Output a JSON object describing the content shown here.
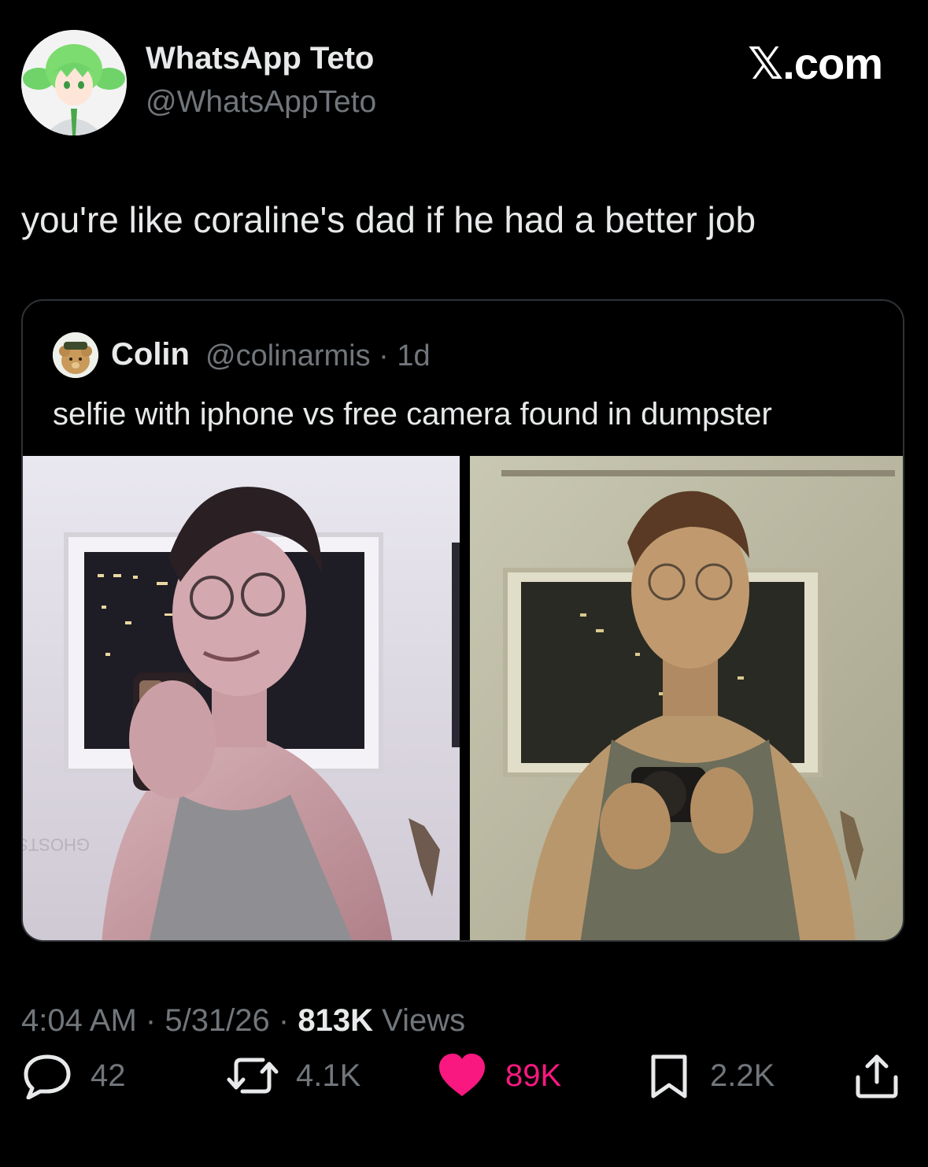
{
  "author": {
    "display_name": "WhatsApp Teto",
    "handle": "@WhatsAppTeto"
  },
  "brand": "𝕏.com",
  "tweet_text": "you're like coraline's dad if he had a better job",
  "quote": {
    "name": "Colin",
    "meta": "@colinarmis · 1d",
    "text": "selfie with iphone vs free camera found in dumpster"
  },
  "footer": {
    "time": "4:04 AM",
    "date": "5/31/26",
    "views_count": "813K",
    "views_label": "Views"
  },
  "actions": {
    "replies": "42",
    "reposts": "4.1K",
    "likes": "89K",
    "bookmarks": "2.2K"
  },
  "colors": {
    "background": "#000000",
    "text_primary": "#e7e9ea",
    "text_secondary": "#71767b",
    "like_pink": "#f91880",
    "border": "#2f3336"
  },
  "icons": [
    "reply-icon",
    "repost-icon",
    "heart-icon",
    "bookmark-icon",
    "share-icon"
  ]
}
